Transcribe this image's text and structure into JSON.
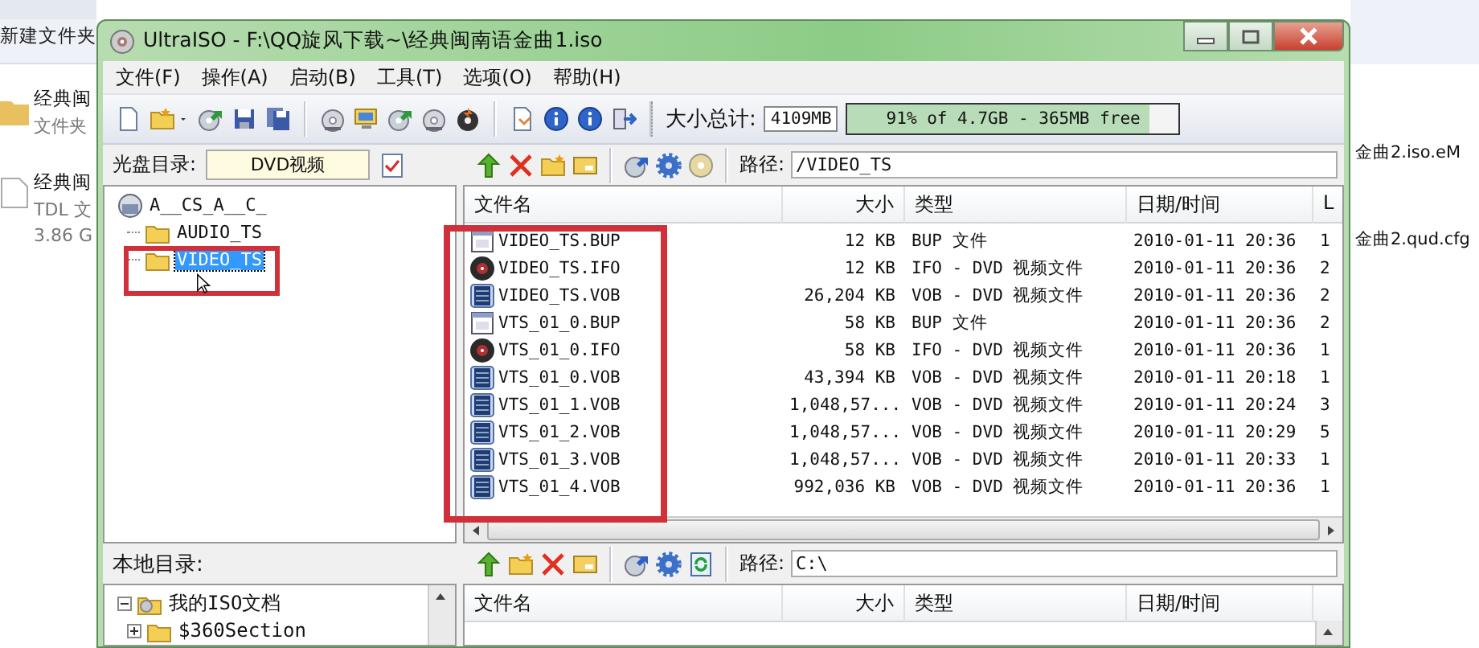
{
  "background_window": {
    "toolbar_item": "新建文件夹",
    "items": [
      {
        "kind": "folder",
        "name": "经典闽",
        "lines": [
          "文件夹"
        ]
      },
      {
        "kind": "file",
        "name": "经典闽",
        "lines": [
          "TDL 文",
          "3.86 G"
        ]
      }
    ],
    "right_items": [
      "金曲2.iso.eM",
      "金曲2.qud.cfg"
    ]
  },
  "window": {
    "title": "UltraISO - F:\\QQ旋风下载~\\经典闽南语金曲1.iso"
  },
  "menu": [
    "文件(F)",
    "操作(A)",
    "启动(B)",
    "工具(T)",
    "选项(O)",
    "帮助(H)"
  ],
  "size_total": {
    "label": "大小总计:",
    "value": "4109MB",
    "capacity": {
      "text": "91% of 4.7GB - 365MB free",
      "level": 0.91
    }
  },
  "disc_panel": {
    "label": "光盘目录:",
    "volume": "DVD视频",
    "tree": [
      {
        "label": "A__CS_A__C_",
        "children": [
          {
            "label": "AUDIO_TS",
            "selected": false
          },
          {
            "label": "VIDEO_TS",
            "selected": true
          }
        ]
      }
    ]
  },
  "disc_files": {
    "path_label": "路径:",
    "path": "/VIDEO_TS",
    "columns": [
      "文件名",
      "大小",
      "类型",
      "日期/时间",
      "L"
    ],
    "rows": [
      {
        "kind": "bup",
        "name": "VIDEO_TS.BUP",
        "size": "12 KB",
        "type": "BUP 文件",
        "date": "2010-01-11 20:36",
        "column_5": "1"
      },
      {
        "kind": "ifo",
        "name": "VIDEO_TS.IFO",
        "size": "12 KB",
        "type": "IFO - DVD 视频文件",
        "date": "2010-01-11 20:36",
        "column_5": "2"
      },
      {
        "kind": "vob",
        "name": "VIDEO_TS.VOB",
        "size": "26,204 KB",
        "type": "VOB - DVD 视频文件",
        "date": "2010-01-11 20:36",
        "column_5": "2"
      },
      {
        "kind": "bup",
        "name": "VTS_01_0.BUP",
        "size": "58 KB",
        "type": "BUP 文件",
        "date": "2010-01-11 20:36",
        "column_5": "2"
      },
      {
        "kind": "ifo",
        "name": "VTS_01_0.IFO",
        "size": "58 KB",
        "type": "IFO - DVD 视频文件",
        "date": "2010-01-11 20:36",
        "column_5": "1"
      },
      {
        "kind": "vob",
        "name": "VTS_01_0.VOB",
        "size": "43,394 KB",
        "type": "VOB - DVD 视频文件",
        "date": "2010-01-11 20:18",
        "column_5": "1"
      },
      {
        "kind": "vob",
        "name": "VTS_01_1.VOB",
        "size": "1,048,57...",
        "type": "VOB - DVD 视频文件",
        "date": "2010-01-11 20:24",
        "column_5": "3"
      },
      {
        "kind": "vob",
        "name": "VTS_01_2.VOB",
        "size": "1,048,57...",
        "type": "VOB - DVD 视频文件",
        "date": "2010-01-11 20:29",
        "column_5": "5"
      },
      {
        "kind": "vob",
        "name": "VTS_01_3.VOB",
        "size": "1,048,57...",
        "type": "VOB - DVD 视频文件",
        "date": "2010-01-11 20:33",
        "column_5": "1"
      },
      {
        "kind": "vob",
        "name": "VTS_01_4.VOB",
        "size": "992,036 KB",
        "type": "VOB - DVD 视频文件",
        "date": "2010-01-11 20:36",
        "column_5": "1"
      }
    ]
  },
  "local_panel": {
    "label": "本地目录:",
    "tree": [
      {
        "label": "我的ISO文档",
        "expanded": true,
        "children": [
          {
            "label": "$360Section",
            "expanded": false
          }
        ]
      }
    ]
  },
  "local_files": {
    "path_label": "路径:",
    "path": "C:\\",
    "columns": [
      "文件名",
      "大小",
      "类型",
      "日期/时间"
    ]
  }
}
